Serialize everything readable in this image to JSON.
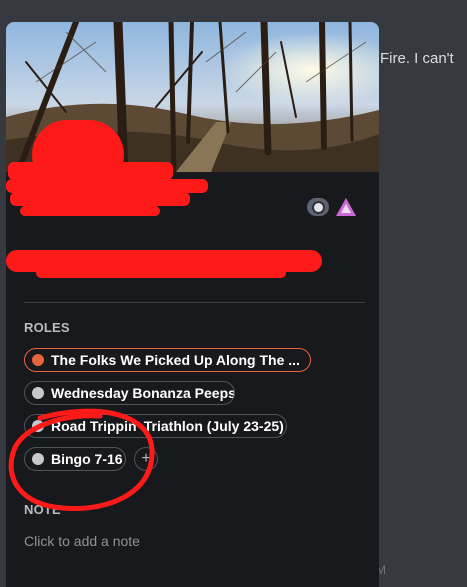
{
  "chat": {
    "message_fragment": "Fire. I can't",
    "corner_mark": "M"
  },
  "profile": {
    "badges": [
      {
        "icon": "nitro-badge-icon"
      },
      {
        "icon": "hypesquad-badge-icon"
      }
    ]
  },
  "roles": {
    "title": "ROLES",
    "items": [
      {
        "label": "The Folks We Picked Up Along The ...",
        "color": "#e8643c"
      },
      {
        "label": "Wednesday Bonanza Peeps",
        "color": "#c7c9cc"
      },
      {
        "label": "Road Trippin' Triathlon (July 23-25)",
        "color": "#c7c9cc"
      },
      {
        "label": "Bingo 7-16",
        "color": "#c7c9cc"
      }
    ],
    "add_label": "+"
  },
  "note": {
    "title": "NOTE",
    "placeholder": "Click to add a note"
  },
  "colors": {
    "redaction": "#ff1a1a",
    "card_bg": "#18191c",
    "chat_bg": "#36393f"
  }
}
